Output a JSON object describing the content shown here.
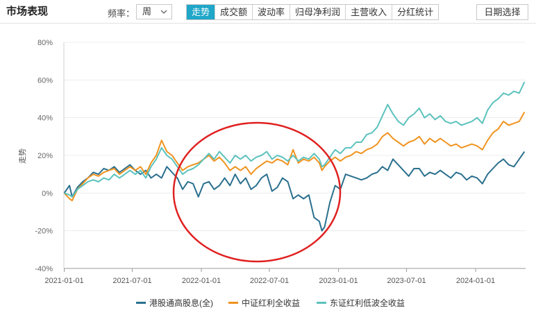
{
  "header": {
    "title": "市场表现",
    "freq_label": "频率：",
    "freq_value": "周",
    "tabs": [
      {
        "label": "走势",
        "active": true
      },
      {
        "label": "成交额",
        "active": false
      },
      {
        "label": "波动率",
        "active": false
      },
      {
        "label": "归母净利润",
        "active": false
      },
      {
        "label": "主营收入",
        "active": false
      },
      {
        "label": "分红统计",
        "active": false
      }
    ],
    "date_button": "日期选择"
  },
  "icons": {
    "freq_dropdown": "chevron-down-icon"
  },
  "colors": {
    "accent": "#1fa6c8",
    "annotation": "#e02020",
    "series": [
      "#2a6f8e",
      "#f0931f",
      "#5cc2bd"
    ]
  },
  "chart_data": {
    "type": "line",
    "ylabel": "走势",
    "ylim": [
      -40,
      80
    ],
    "yticks": [
      "-40%",
      "-20%",
      "0%",
      "20%",
      "40%",
      "60%",
      "80%"
    ],
    "xticks": [
      "2021-01-01",
      "2021-07-01",
      "2022-01-01",
      "2022-07-01",
      "2023-01-01",
      "2023-07-01",
      "2024-01-01"
    ],
    "xrange": [
      "2020-12-31",
      "2024-05-13"
    ],
    "grid": "horizontal",
    "legend_position": "bottom",
    "annotation": "red ellipse highlighting 2022 period",
    "series": [
      {
        "name": "港股通高股息(全)",
        "color": "#2a6f8e",
        "points": [
          [
            "2021-01-01",
            0
          ],
          [
            "2021-01-15",
            4
          ],
          [
            "2021-01-22",
            -2
          ],
          [
            "2021-02-05",
            3
          ],
          [
            "2021-02-19",
            6
          ],
          [
            "2021-03-05",
            8
          ],
          [
            "2021-03-19",
            11
          ],
          [
            "2021-04-02",
            10
          ],
          [
            "2021-04-16",
            13
          ],
          [
            "2021-04-30",
            12
          ],
          [
            "2021-05-14",
            14
          ],
          [
            "2021-05-28",
            11
          ],
          [
            "2021-06-11",
            13
          ],
          [
            "2021-06-25",
            15
          ],
          [
            "2021-07-09",
            12
          ],
          [
            "2021-07-23",
            10
          ],
          [
            "2021-08-06",
            12
          ],
          [
            "2021-08-20",
            8
          ],
          [
            "2021-09-03",
            10
          ],
          [
            "2021-09-17",
            8
          ],
          [
            "2021-10-01",
            14
          ],
          [
            "2021-10-15",
            11
          ],
          [
            "2021-10-29",
            8
          ],
          [
            "2021-11-12",
            2
          ],
          [
            "2021-11-26",
            6
          ],
          [
            "2021-12-10",
            5
          ],
          [
            "2021-12-24",
            -2
          ],
          [
            "2022-01-07",
            5
          ],
          [
            "2022-01-21",
            6
          ],
          [
            "2022-02-04",
            2
          ],
          [
            "2022-02-18",
            4
          ],
          [
            "2022-03-04",
            8
          ],
          [
            "2022-03-18",
            4
          ],
          [
            "2022-04-01",
            10
          ],
          [
            "2022-04-15",
            5
          ],
          [
            "2022-04-29",
            8
          ],
          [
            "2022-05-13",
            2
          ],
          [
            "2022-05-27",
            4
          ],
          [
            "2022-06-10",
            8
          ],
          [
            "2022-06-24",
            10
          ],
          [
            "2022-07-08",
            1
          ],
          [
            "2022-07-22",
            3
          ],
          [
            "2022-08-05",
            8
          ],
          [
            "2022-08-19",
            6
          ],
          [
            "2022-09-02",
            -3
          ],
          [
            "2022-09-16",
            -1
          ],
          [
            "2022-09-30",
            -3
          ],
          [
            "2022-10-14",
            -1
          ],
          [
            "2022-10-28",
            -13
          ],
          [
            "2022-11-11",
            -15
          ],
          [
            "2022-11-18",
            -20
          ],
          [
            "2022-11-25",
            -18
          ],
          [
            "2022-12-09",
            -5
          ],
          [
            "2022-12-23",
            4
          ],
          [
            "2023-01-06",
            2
          ],
          [
            "2023-01-20",
            10
          ],
          [
            "2023-02-03",
            9
          ],
          [
            "2023-02-17",
            8
          ],
          [
            "2023-03-03",
            7
          ],
          [
            "2023-03-17",
            8
          ],
          [
            "2023-03-31",
            10
          ],
          [
            "2023-04-14",
            11
          ],
          [
            "2023-04-28",
            14
          ],
          [
            "2023-05-12",
            12
          ],
          [
            "2023-05-26",
            18
          ],
          [
            "2023-06-09",
            15
          ],
          [
            "2023-06-23",
            12
          ],
          [
            "2023-07-07",
            9
          ],
          [
            "2023-07-21",
            13
          ],
          [
            "2023-08-04",
            13
          ],
          [
            "2023-08-18",
            9
          ],
          [
            "2023-09-01",
            11
          ],
          [
            "2023-09-15",
            10
          ],
          [
            "2023-09-29",
            12
          ],
          [
            "2023-10-13",
            10
          ],
          [
            "2023-10-27",
            8
          ],
          [
            "2023-11-10",
            11
          ],
          [
            "2023-11-24",
            10
          ],
          [
            "2023-12-08",
            7
          ],
          [
            "2023-12-22",
            9
          ],
          [
            "2024-01-05",
            8
          ],
          [
            "2024-01-19",
            5
          ],
          [
            "2024-02-02",
            10
          ],
          [
            "2024-02-16",
            13
          ],
          [
            "2024-03-01",
            16
          ],
          [
            "2024-03-15",
            18
          ],
          [
            "2024-03-29",
            15
          ],
          [
            "2024-04-12",
            14
          ],
          [
            "2024-04-26",
            18
          ],
          [
            "2024-05-10",
            22
          ]
        ]
      },
      {
        "name": "中证红利全收益",
        "color": "#f0931f",
        "points": [
          [
            "2021-01-01",
            0
          ],
          [
            "2021-01-15",
            -3
          ],
          [
            "2021-01-22",
            -4
          ],
          [
            "2021-02-05",
            2
          ],
          [
            "2021-02-19",
            5
          ],
          [
            "2021-03-05",
            8
          ],
          [
            "2021-03-19",
            10
          ],
          [
            "2021-04-02",
            9
          ],
          [
            "2021-04-16",
            11
          ],
          [
            "2021-04-30",
            12
          ],
          [
            "2021-05-14",
            13
          ],
          [
            "2021-05-28",
            10
          ],
          [
            "2021-06-11",
            12
          ],
          [
            "2021-06-25",
            14
          ],
          [
            "2021-07-09",
            12
          ],
          [
            "2021-07-23",
            14
          ],
          [
            "2021-08-06",
            10
          ],
          [
            "2021-08-20",
            16
          ],
          [
            "2021-09-03",
            20
          ],
          [
            "2021-09-17",
            28
          ],
          [
            "2021-10-01",
            22
          ],
          [
            "2021-10-15",
            20
          ],
          [
            "2021-10-29",
            16
          ],
          [
            "2021-11-12",
            12
          ],
          [
            "2021-11-26",
            14
          ],
          [
            "2021-12-10",
            15
          ],
          [
            "2021-12-24",
            16
          ],
          [
            "2022-01-07",
            18
          ],
          [
            "2022-01-21",
            20
          ],
          [
            "2022-02-04",
            17
          ],
          [
            "2022-02-18",
            19
          ],
          [
            "2022-03-04",
            16
          ],
          [
            "2022-03-18",
            12
          ],
          [
            "2022-04-01",
            14
          ],
          [
            "2022-04-15",
            12
          ],
          [
            "2022-04-29",
            14
          ],
          [
            "2022-05-13",
            10
          ],
          [
            "2022-05-27",
            13
          ],
          [
            "2022-06-10",
            15
          ],
          [
            "2022-06-24",
            17
          ],
          [
            "2022-07-08",
            16
          ],
          [
            "2022-07-22",
            18
          ],
          [
            "2022-08-05",
            17
          ],
          [
            "2022-08-19",
            15
          ],
          [
            "2022-09-02",
            23
          ],
          [
            "2022-09-16",
            16
          ],
          [
            "2022-09-30",
            18
          ],
          [
            "2022-10-14",
            17
          ],
          [
            "2022-10-28",
            19
          ],
          [
            "2022-11-11",
            16
          ],
          [
            "2022-11-18",
            12
          ],
          [
            "2022-11-25",
            14
          ],
          [
            "2022-12-09",
            17
          ],
          [
            "2022-12-23",
            19
          ],
          [
            "2023-01-06",
            17
          ],
          [
            "2023-01-20",
            19
          ],
          [
            "2023-02-03",
            20
          ],
          [
            "2023-02-17",
            22
          ],
          [
            "2023-03-03",
            21
          ],
          [
            "2023-03-17",
            23
          ],
          [
            "2023-03-31",
            24
          ],
          [
            "2023-04-14",
            26
          ],
          [
            "2023-04-28",
            30
          ],
          [
            "2023-05-12",
            32
          ],
          [
            "2023-05-26",
            29
          ],
          [
            "2023-06-09",
            27
          ],
          [
            "2023-06-23",
            25
          ],
          [
            "2023-07-07",
            27
          ],
          [
            "2023-07-21",
            28
          ],
          [
            "2023-08-04",
            30
          ],
          [
            "2023-08-18",
            26
          ],
          [
            "2023-09-01",
            29
          ],
          [
            "2023-09-15",
            27
          ],
          [
            "2023-09-29",
            29
          ],
          [
            "2023-10-13",
            27
          ],
          [
            "2023-10-27",
            25
          ],
          [
            "2023-11-10",
            26
          ],
          [
            "2023-11-24",
            24
          ],
          [
            "2023-12-08",
            25
          ],
          [
            "2023-12-22",
            26
          ],
          [
            "2024-01-05",
            25
          ],
          [
            "2024-01-19",
            23
          ],
          [
            "2024-02-02",
            28
          ],
          [
            "2024-02-16",
            32
          ],
          [
            "2024-03-01",
            34
          ],
          [
            "2024-03-15",
            38
          ],
          [
            "2024-03-29",
            36
          ],
          [
            "2024-04-12",
            37
          ],
          [
            "2024-04-26",
            38
          ],
          [
            "2024-05-10",
            43
          ]
        ]
      },
      {
        "name": "东证红利低波全收益",
        "color": "#5cc2bd",
        "points": [
          [
            "2021-01-01",
            0
          ],
          [
            "2021-01-15",
            -1
          ],
          [
            "2021-01-22",
            -2
          ],
          [
            "2021-02-05",
            2
          ],
          [
            "2021-02-19",
            4
          ],
          [
            "2021-03-05",
            6
          ],
          [
            "2021-03-19",
            7
          ],
          [
            "2021-04-02",
            6
          ],
          [
            "2021-04-16",
            8
          ],
          [
            "2021-04-30",
            7
          ],
          [
            "2021-05-14",
            10
          ],
          [
            "2021-05-28",
            8
          ],
          [
            "2021-06-11",
            10
          ],
          [
            "2021-06-25",
            12
          ],
          [
            "2021-07-09",
            10
          ],
          [
            "2021-07-23",
            12
          ],
          [
            "2021-08-06",
            8
          ],
          [
            "2021-08-20",
            14
          ],
          [
            "2021-09-03",
            18
          ],
          [
            "2021-09-17",
            24
          ],
          [
            "2021-10-01",
            20
          ],
          [
            "2021-10-15",
            18
          ],
          [
            "2021-10-29",
            14
          ],
          [
            "2021-11-12",
            10
          ],
          [
            "2021-11-26",
            12
          ],
          [
            "2021-12-10",
            13
          ],
          [
            "2021-12-24",
            15
          ],
          [
            "2022-01-07",
            18
          ],
          [
            "2022-01-21",
            21
          ],
          [
            "2022-02-04",
            18
          ],
          [
            "2022-02-18",
            22
          ],
          [
            "2022-03-04",
            19
          ],
          [
            "2022-03-18",
            16
          ],
          [
            "2022-04-01",
            20
          ],
          [
            "2022-04-15",
            18
          ],
          [
            "2022-04-29",
            20
          ],
          [
            "2022-05-13",
            17
          ],
          [
            "2022-05-27",
            19
          ],
          [
            "2022-06-10",
            20
          ],
          [
            "2022-06-24",
            22
          ],
          [
            "2022-07-08",
            18
          ],
          [
            "2022-07-22",
            20
          ],
          [
            "2022-08-05",
            19
          ],
          [
            "2022-08-19",
            17
          ],
          [
            "2022-09-02",
            20
          ],
          [
            "2022-09-16",
            17
          ],
          [
            "2022-09-30",
            19
          ],
          [
            "2022-10-14",
            18
          ],
          [
            "2022-10-28",
            21
          ],
          [
            "2022-11-11",
            18
          ],
          [
            "2022-11-18",
            14
          ],
          [
            "2022-11-25",
            15
          ],
          [
            "2022-12-09",
            19
          ],
          [
            "2022-12-23",
            23
          ],
          [
            "2023-01-06",
            21
          ],
          [
            "2023-01-20",
            24
          ],
          [
            "2023-02-03",
            24
          ],
          [
            "2023-02-17",
            27
          ],
          [
            "2023-03-03",
            27
          ],
          [
            "2023-03-17",
            31
          ],
          [
            "2023-03-31",
            32
          ],
          [
            "2023-04-14",
            35
          ],
          [
            "2023-04-28",
            41
          ],
          [
            "2023-05-12",
            47
          ],
          [
            "2023-05-26",
            42
          ],
          [
            "2023-06-09",
            38
          ],
          [
            "2023-06-23",
            36
          ],
          [
            "2023-07-07",
            40
          ],
          [
            "2023-07-21",
            42
          ],
          [
            "2023-08-04",
            45
          ],
          [
            "2023-08-18",
            40
          ],
          [
            "2023-09-01",
            42
          ],
          [
            "2023-09-15",
            39
          ],
          [
            "2023-09-29",
            41
          ],
          [
            "2023-10-13",
            38
          ],
          [
            "2023-10-27",
            37
          ],
          [
            "2023-11-10",
            38
          ],
          [
            "2023-11-24",
            36
          ],
          [
            "2023-12-08",
            37
          ],
          [
            "2023-12-22",
            38
          ],
          [
            "2024-01-05",
            40
          ],
          [
            "2024-01-19",
            37
          ],
          [
            "2024-02-02",
            44
          ],
          [
            "2024-02-16",
            48
          ],
          [
            "2024-03-01",
            50
          ],
          [
            "2024-03-15",
            53
          ],
          [
            "2024-03-29",
            52
          ],
          [
            "2024-04-12",
            54
          ],
          [
            "2024-04-26",
            53
          ],
          [
            "2024-05-10",
            59
          ]
        ]
      }
    ]
  }
}
